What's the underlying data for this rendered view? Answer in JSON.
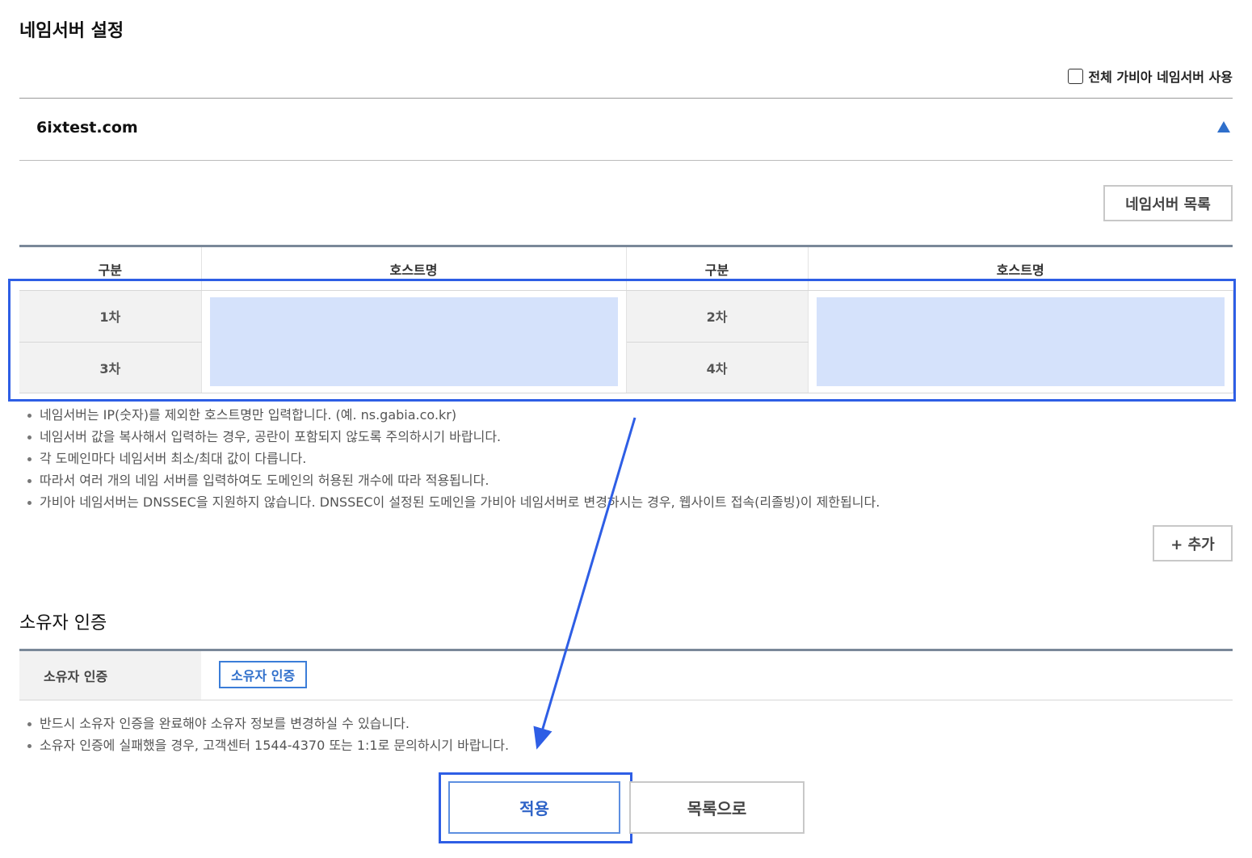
{
  "page": {
    "title": "네임서버 설정"
  },
  "all_gabia_ns": {
    "label": "전체 가비아 네임서버 사용",
    "checked": false
  },
  "domain": {
    "name": "6ixtest.com",
    "collapse_icon": "triangle-up-icon"
  },
  "ns_list_button": "네임서버 목록",
  "ns_table": {
    "headers": [
      "구분",
      "호스트명",
      "구분",
      "호스트명"
    ],
    "rows": [
      {
        "left_label": "1차",
        "right_label": "2차"
      },
      {
        "left_label": "3차",
        "right_label": "4차"
      }
    ]
  },
  "ns_notes": [
    "네임서버는 IP(숫자)를 제외한 호스트명만 입력합니다. (예. ns.gabia.co.kr)",
    "네임서버 값을 복사해서 입력하는 경우, 공란이 포함되지 않도록 주의하시기 바랍니다.",
    "각 도메인마다 네임서버 최소/최대 값이 다릅니다.",
    "따라서 여러 개의 네임 서버를 입력하여도 도메인의 허용된 개수에 따라 적용됩니다.",
    "가비아 네임서버는 DNSSEC을 지원하지 않습니다. DNSSEC이 설정된 도메인을 가비아 네임서버로 변경하시는 경우, 웹사이트 접속(리졸빙)이 제한됩니다."
  ],
  "add_button": "+ 추가",
  "owner_section": {
    "title": "소유자 인증",
    "row_label": "소유자 인증",
    "verify_button": "소유자 인증",
    "notes": [
      "반드시 소유자 인증을 완료해야 소유자 정보를 변경하실 수 있습니다.",
      "소유자 인증에 실패했을 경우, 고객센터 1544-4370 또는 1:1로 문의하시기 바랍니다."
    ]
  },
  "actions": {
    "apply": "적용",
    "back_to_list": "목록으로"
  },
  "colors": {
    "highlight": "#2e5ee5",
    "host_input_fill": "#d5e2fb",
    "accent_blue": "#3b7dd8"
  }
}
